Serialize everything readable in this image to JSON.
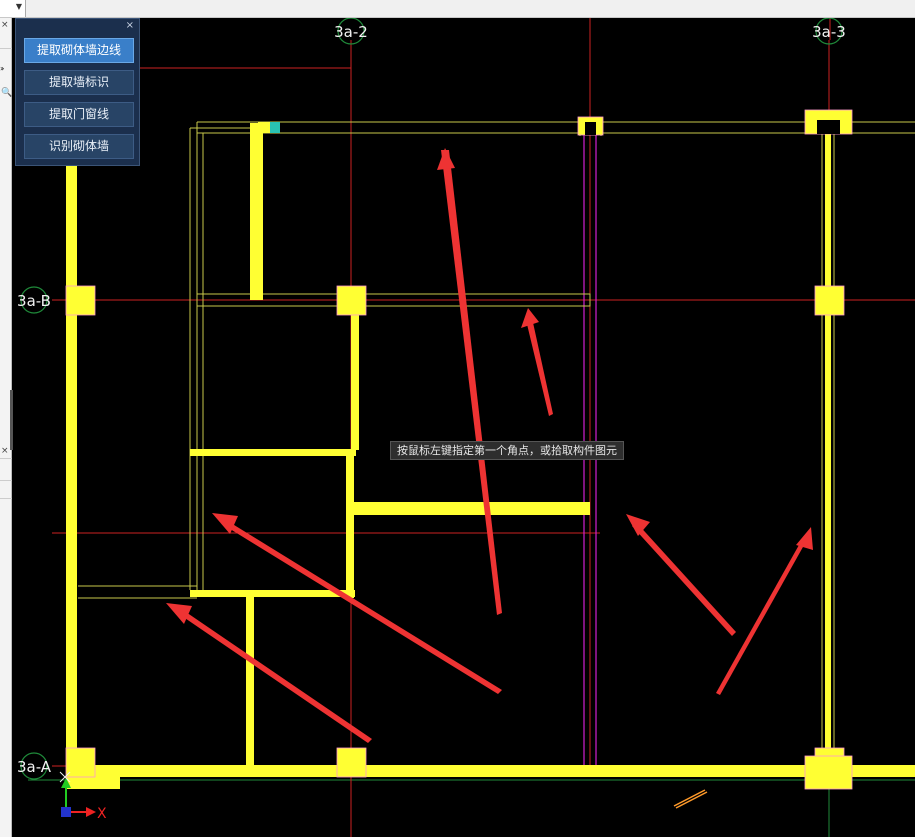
{
  "toolbar": {
    "buttons": [
      {
        "label": "提取砌体墙边线",
        "active": true
      },
      {
        "label": "提取墙标识",
        "active": false
      },
      {
        "label": "提取门窗线",
        "active": false
      },
      {
        "label": "识别砌体墙",
        "active": false
      }
    ],
    "close_glyph": "×"
  },
  "left_panel": {
    "close_glyph": "×",
    "expand_glyph": "››",
    "search_glyph": "🔍"
  },
  "axes": {
    "columns": [
      "3a-2",
      "3a-3"
    ],
    "rows": [
      "3a-B",
      "3a-A"
    ]
  },
  "status_tooltip": "按鼠标左键指定第一个角点，或拾取构件图元",
  "ucs": {
    "x_label": "X"
  },
  "colors": {
    "wall": "#ffff33",
    "edge_line": "#c8c84a",
    "axis_line": "#cc2222",
    "grid_green": "#1f8a3a",
    "magenta": "#d020d0",
    "annotation_arrow": "#ee3333",
    "panel_bg": "#1b2f4d",
    "button_active": "#3a7fc9"
  }
}
